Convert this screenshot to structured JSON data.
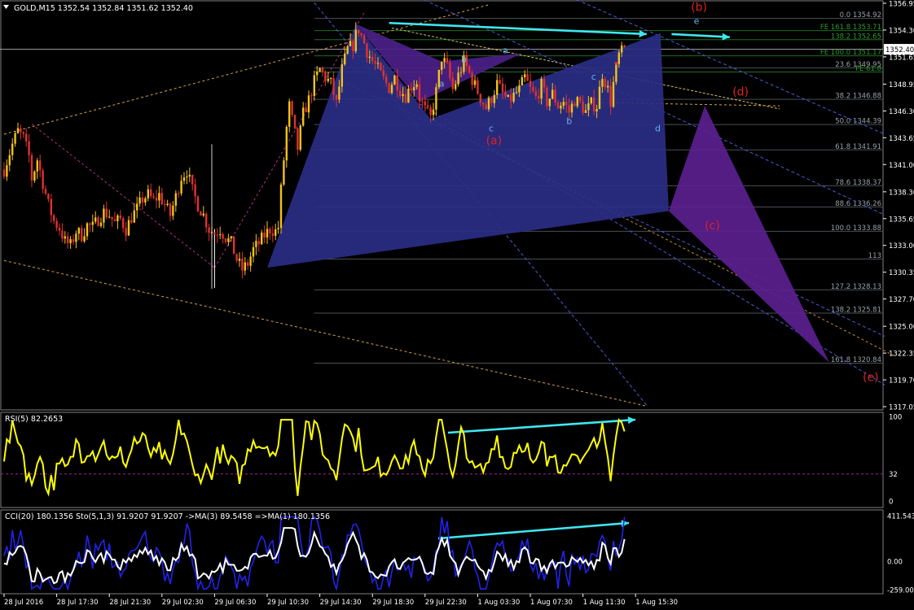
{
  "main": {
    "symbol_line": "GOLD,M15  1352.54 1352.84 1351.62 1352.40",
    "current_price": "1352.40",
    "price_ticks": [
      {
        "label": "1356.95",
        "v": 1356.95
      },
      {
        "label": "1354.30",
        "v": 1354.3
      },
      {
        "label": "1351.65",
        "v": 1351.65
      },
      {
        "label": "1348.95",
        "v": 1348.95
      },
      {
        "label": "1346.30",
        "v": 1346.3
      },
      {
        "label": "1343.65",
        "v": 1343.65
      },
      {
        "label": "1341.00",
        "v": 1341.0
      },
      {
        "label": "1338.30",
        "v": 1338.3
      },
      {
        "label": "1335.65",
        "v": 1335.65
      },
      {
        "label": "1333.00",
        "v": 1333.0
      },
      {
        "label": "1330.35",
        "v": 1330.35
      },
      {
        "label": "1327.70",
        "v": 1327.7
      },
      {
        "label": "1325.00",
        "v": 1325.0
      },
      {
        "label": "1322.35",
        "v": 1322.35
      },
      {
        "label": "1319.70",
        "v": 1319.7
      },
      {
        "label": "1317.05",
        "v": 1317.05
      }
    ],
    "fib_levels": [
      {
        "label": "0.0 1354.92",
        "v": 1355.45,
        "color": "#9aa0a6"
      },
      {
        "label": "FE 161.8 1353.71",
        "v": 1354.25,
        "color": "#2e9a2e"
      },
      {
        "label": "138.2 1352.65",
        "v": 1353.35,
        "color": "#2e9a2e"
      },
      {
        "label": "FE 100.0 1351.17",
        "v": 1351.75,
        "color": "#2e9a2e"
      },
      {
        "label": "23.6 1349.95",
        "v": 1350.55,
        "color": "#9aa0a6"
      },
      {
        "label": "FE 61.8",
        "v": 1350.15,
        "color": "#2e9a2e"
      },
      {
        "label": "38.2 1346.88",
        "v": 1347.45,
        "color": "#9aa0a6"
      },
      {
        "label": "50.0 1344.39",
        "v": 1344.95,
        "color": "#9aa0a6"
      },
      {
        "label": "61.8 1341.91",
        "v": 1342.45,
        "color": "#9aa0a6"
      },
      {
        "label": "78.6 1338.37",
        "v": 1338.9,
        "color": "#9aa0a6"
      },
      {
        "label": "88.6 1336.26",
        "v": 1336.8,
        "color": "#9aa0a6"
      },
      {
        "label": "100.0 1333.88",
        "v": 1334.4,
        "color": "#9aa0a6"
      },
      {
        "label": "113",
        "v": 1331.65,
        "color": "#9aa0a6"
      },
      {
        "label": "127.2 1328.13",
        "v": 1328.6,
        "color": "#9aa0a6"
      },
      {
        "label": "138.2 1325.81",
        "v": 1326.3,
        "color": "#9aa0a6"
      },
      {
        "label": "161.8 1320.84",
        "v": 1321.35,
        "color": "#9aa0a6"
      }
    ],
    "wave_labels_red": [
      {
        "t": "(b)",
        "bar": 248,
        "v": 1356.2
      },
      {
        "t": "(a)",
        "bar": 174,
        "v": 1343.0
      },
      {
        "t": "(d)",
        "bar": 263,
        "v": 1347.8
      },
      {
        "t": "(c)",
        "bar": 253,
        "v": 1334.6
      },
      {
        "t": "(e)",
        "bar": 310,
        "v": 1319.6
      }
    ],
    "wave_labels_cyan": [
      {
        "t": "e",
        "bar": 249,
        "v": 1354.9
      },
      {
        "t": "a",
        "bar": 180,
        "v": 1352.0
      },
      {
        "t": "b",
        "bar": 165,
        "v": 1351.1
      },
      {
        "t": "a",
        "bar": 157,
        "v": 1348.7
      },
      {
        "t": "c",
        "bar": 212,
        "v": 1349.4
      },
      {
        "t": "c",
        "bar": 175,
        "v": 1344.3
      },
      {
        "t": "b",
        "bar": 203,
        "v": 1345.0
      },
      {
        "t": "d",
        "bar": 235,
        "v": 1344.3
      }
    ]
  },
  "rsi": {
    "label": "RSI(5) 82.2653",
    "ticks": [
      {
        "label": "100",
        "v": 100
      },
      {
        "label": "32",
        "v": 32
      },
      {
        "label": "0",
        "v": 0
      }
    ]
  },
  "cci": {
    "label": "CCI(20) 180.1356  Sto(5,1,3) 91.9207 91.9207  ->MA(3) 89.5458  =>MA(1) 180.1356",
    "ticks": [
      {
        "label": "411.543",
        "v": 411.543
      },
      {
        "label": "0.00",
        "v": 0
      },
      {
        "label": "-259.007",
        "v": -259.007
      }
    ]
  },
  "time_axis": [
    {
      "label": "28 Jul 2016",
      "bar": 0
    },
    {
      "label": "28 Jul 17:30",
      "bar": 19
    },
    {
      "label": "28 Jul 21:30",
      "bar": 38
    },
    {
      "label": "29 Jul 02:30",
      "bar": 57
    },
    {
      "label": "29 Jul 06:30",
      "bar": 76
    },
    {
      "label": "29 Jul 10:30",
      "bar": 95
    },
    {
      "label": "29 Jul 14:30",
      "bar": 114
    },
    {
      "label": "29 Jul 18:30",
      "bar": 133
    },
    {
      "label": "29 Jul 22:30",
      "bar": 152
    },
    {
      "label": "1 Aug 03:30",
      "bar": 171
    },
    {
      "label": "1 Aug 07:30",
      "bar": 190
    },
    {
      "label": "1 Aug 11:30",
      "bar": 209
    },
    {
      "label": "1 Aug 15:30",
      "bar": 228
    }
  ],
  "chart_data": [
    {
      "type": "candlestick",
      "title": "GOLD,M15",
      "ohlc_last": {
        "open": 1352.54,
        "high": 1352.84,
        "low": 1351.62,
        "close": 1352.4
      },
      "close_path": [
        [
          0,
          1340.5
        ],
        [
          3,
          1343.0
        ],
        [
          5,
          1344.3
        ],
        [
          7,
          1343.6
        ],
        [
          9,
          1341.8
        ],
        [
          10,
          1339.6
        ],
        [
          12,
          1341.5
        ],
        [
          14,
          1339.2
        ],
        [
          16,
          1337.0
        ],
        [
          18,
          1335.4
        ],
        [
          20,
          1334.7
        ],
        [
          22,
          1333.4
        ],
        [
          24,
          1333.0
        ],
        [
          26,
          1334.4
        ],
        [
          28,
          1334.0
        ],
        [
          30,
          1335.0
        ],
        [
          32,
          1334.8
        ],
        [
          34,
          1335.6
        ],
        [
          36,
          1336.3
        ],
        [
          38,
          1336.0
        ],
        [
          40,
          1335.2
        ],
        [
          42,
          1335.6
        ],
        [
          44,
          1334.6
        ],
        [
          46,
          1335.8
        ],
        [
          48,
          1336.6
        ],
        [
          50,
          1337.6
        ],
        [
          52,
          1338.0
        ],
        [
          54,
          1337.4
        ],
        [
          56,
          1338.0
        ],
        [
          58,
          1337.0
        ],
        [
          60,
          1336.0
        ],
        [
          62,
          1337.8
        ],
        [
          64,
          1339.8
        ],
        [
          66,
          1340.4
        ],
        [
          68,
          1338.4
        ],
        [
          70,
          1337.0
        ],
        [
          72,
          1336.0
        ],
        [
          74,
          1334.6
        ],
        [
          76,
          1334.2
        ],
        [
          78,
          1334.6
        ],
        [
          80,
          1333.8
        ],
        [
          82,
          1333.2
        ],
        [
          84,
          1331.6
        ],
        [
          86,
          1330.6
        ],
        [
          88,
          1331.2
        ],
        [
          90,
          1332.6
        ],
        [
          92,
          1333.2
        ],
        [
          94,
          1334.0
        ],
        [
          96,
          1334.6
        ],
        [
          98,
          1334.4
        ],
        [
          99,
          1334.8
        ],
        [
          100,
          1338.5
        ],
        [
          101,
          1341.5
        ],
        [
          102,
          1344.6
        ],
        [
          103,
          1346.8
        ],
        [
          104,
          1345.4
        ],
        [
          106,
          1342.6
        ],
        [
          108,
          1346.0
        ],
        [
          110,
          1347.4
        ],
        [
          112,
          1349.2
        ],
        [
          114,
          1350.4
        ],
        [
          116,
          1349.6
        ],
        [
          118,
          1349.0
        ],
        [
          120,
          1347.0
        ],
        [
          122,
          1350.4
        ],
        [
          124,
          1352.4
        ],
        [
          126,
          1352.8
        ],
        [
          127,
          1353.8
        ],
        [
          128,
          1354.4
        ],
        [
          130,
          1353.0
        ],
        [
          131,
          1352.2
        ],
        [
          133,
          1351.2
        ],
        [
          135,
          1350.4
        ],
        [
          137,
          1349.4
        ],
        [
          139,
          1348.6
        ],
        [
          141,
          1349.6
        ],
        [
          143,
          1348.4
        ],
        [
          145,
          1347.8
        ],
        [
          147,
          1348.8
        ],
        [
          149,
          1349.2
        ],
        [
          150,
          1347.6
        ],
        [
          152,
          1346.4
        ],
        [
          154,
          1345.6
        ],
        [
          156,
          1348.2
        ],
        [
          158,
          1351.6
        ],
        [
          160,
          1350.6
        ],
        [
          162,
          1348.4
        ],
        [
          164,
          1349.8
        ],
        [
          166,
          1351.2
        ],
        [
          168,
          1350.0
        ],
        [
          170,
          1348.8
        ],
        [
          172,
          1347.6
        ],
        [
          174,
          1346.6
        ],
        [
          176,
          1347.6
        ],
        [
          178,
          1349.0
        ],
        [
          180,
          1348.0
        ],
        [
          182,
          1347.2
        ],
        [
          184,
          1347.8
        ],
        [
          186,
          1348.4
        ],
        [
          188,
          1349.6
        ],
        [
          190,
          1348.4
        ],
        [
          192,
          1347.6
        ],
        [
          194,
          1348.8
        ],
        [
          196,
          1347.2
        ],
        [
          198,
          1348.0
        ],
        [
          200,
          1346.8
        ],
        [
          202,
          1347.2
        ],
        [
          204,
          1346.2
        ],
        [
          206,
          1347.4
        ],
        [
          208,
          1347.0
        ],
        [
          210,
          1346.2
        ],
        [
          212,
          1347.0
        ],
        [
          214,
          1346.8
        ],
        [
          216,
          1350.0
        ],
        [
          218,
          1348.4
        ],
        [
          219,
          1347.2
        ],
        [
          220,
          1349.0
        ],
        [
          222,
          1351.8
        ],
        [
          224,
          1352.4
        ]
      ],
      "patterns": [
        {
          "name": "blue_harmonic",
          "fill": "#2a2e86",
          "points": [
            [
              95,
              1330.8
            ],
            [
              127,
              1354.9
            ],
            [
              154,
              1345.5
            ],
            [
              237,
              1354.0
            ],
            [
              240,
              1336.4
            ]
          ]
        },
        {
          "name": "purple_triangle_top",
          "fill": "#4b1f87",
          "points": [
            [
              127,
              1354.9
            ],
            [
              158,
              1351.2
            ],
            [
              187,
              1352.0
            ],
            [
              150,
              1347.2
            ]
          ]
        },
        {
          "name": "purple_projection",
          "fill": "#5a1f8f",
          "points": [
            [
              240,
              1336.4
            ],
            [
              253,
              1346.8
            ],
            [
              298,
              1321.4
            ]
          ]
        }
      ],
      "arrows": [
        {
          "from": [
            139,
            1355.0
          ],
          "to": [
            232,
            1353.9
          ]
        },
        {
          "from": [
            241,
            1353.9
          ],
          "to": [
            262,
            1353.6
          ]
        }
      ]
    },
    {
      "type": "line",
      "name": "RSI(5)",
      "last": 82.2653,
      "ylim": [
        0,
        100
      ]
    },
    {
      "type": "line",
      "name": "CCI(20) / Sto(5,1,3)",
      "cci_last": 180.1356,
      "sto": 91.9207,
      "ma3": 89.5458,
      "ylim": [
        -259.007,
        411.543
      ]
    }
  ],
  "colors": {
    "bull": "#f2c21a",
    "bear": "#e23030",
    "rsi": "#ffff00",
    "cci": "#2222ee",
    "sto": "#ffffff",
    "cyan": "#3ee7f0",
    "wave_red": "#e02020"
  }
}
